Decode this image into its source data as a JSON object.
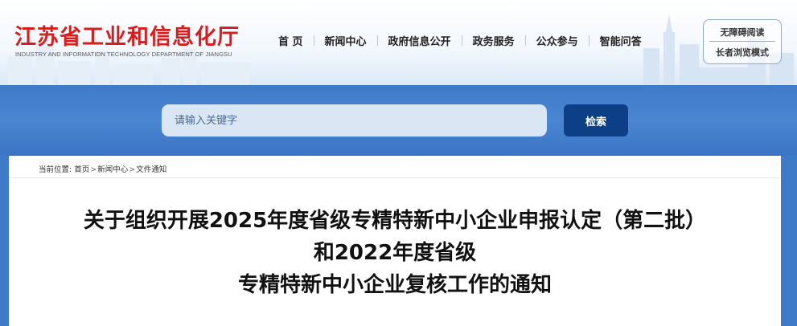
{
  "header": {
    "site_name": "江苏省工业和信息化厅",
    "site_name_en": "INDUSTRY AND INFORMATION TECHNOLOGY DEPARTMENT OF JIANGSU",
    "nav": [
      {
        "label": "首 页"
      },
      {
        "label": "新闻中心"
      },
      {
        "label": "政府信息公开"
      },
      {
        "label": "政务服务"
      },
      {
        "label": "公众参与"
      },
      {
        "label": "智能问答"
      }
    ],
    "accessibility_label": "无障碍阅读",
    "elder_mode_label": "长者浏览模式"
  },
  "search": {
    "placeholder": "请输入关键字",
    "button_label": "检索"
  },
  "breadcrumb": {
    "prefix": "当前位置:",
    "items": [
      "首页",
      "新闻中心",
      "文件通知"
    ],
    "separator": ">"
  },
  "article": {
    "title_lines": [
      "关于组织开展2025年度省级专精特新中小企业申报认定（第二批）",
      "和2022年度省级",
      "专精特新中小企业复核工作的通知"
    ]
  },
  "colors": {
    "brand_red": "#d71e1e",
    "band_blue": "#3f7ac9",
    "button_navy": "#0d3f86"
  }
}
